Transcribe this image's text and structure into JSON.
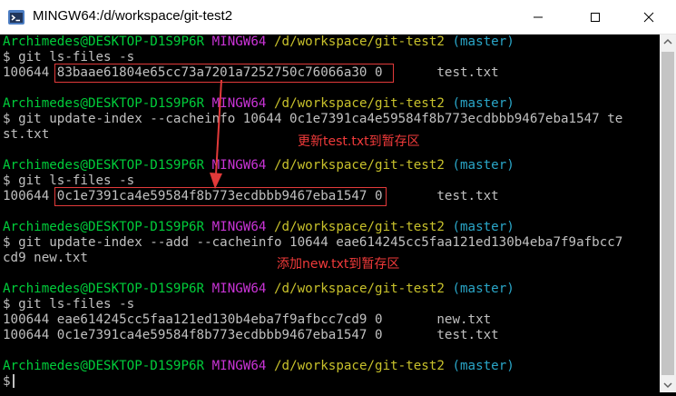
{
  "window": {
    "title": "MINGW64:/d/workspace/git-test2"
  },
  "prompt": {
    "user": "Archimedes@DESKTOP-D1S9P6R",
    "shell": "MINGW64",
    "path": "/d/workspace/git-test2",
    "branch": "(master)",
    "symbol": "$"
  },
  "commands": {
    "ls_files": "git ls-files -s",
    "update_index_1a": "git update-index --cacheinfo 10644 0c1e7391ca4e59584f8b773ecdbbb9467eba1547 te",
    "update_index_1b": "st.txt",
    "update_index_2a": "git update-index --add --cacheinfo 10644 eae614245cc5faa121ed130b4eba7f9afbcc7",
    "update_index_2b": "cd9 new.txt"
  },
  "outputs": {
    "entry1": {
      "mode": "100644",
      "hash": "83baae61804e65cc73a7201a7252750c76066a30",
      "stage": "0",
      "file": "test.txt"
    },
    "entry2": {
      "mode": "100644",
      "hash": "0c1e7391ca4e59584f8b773ecdbbb9467eba1547",
      "stage": "0",
      "file": "test.txt"
    },
    "entry3a": {
      "mode": "100644",
      "hash": "eae614245cc5faa121ed130b4eba7f9afbcc7cd9",
      "stage": "0",
      "file": "new.txt"
    },
    "entry3b": {
      "mode": "100644",
      "hash": "0c1e7391ca4e59584f8b773ecdbbb9467eba1547",
      "stage": "0",
      "file": "test.txt"
    }
  },
  "annotations": {
    "note1": "更新test.txt到暂存区",
    "note2": "添加new.txt到暂存区"
  },
  "colors": {
    "prompt_user": "#00cd3a",
    "prompt_shell": "#c934d6",
    "prompt_path": "#c8c12b",
    "prompt_branch": "#2aa6c8",
    "annotation": "#f03a3a"
  }
}
